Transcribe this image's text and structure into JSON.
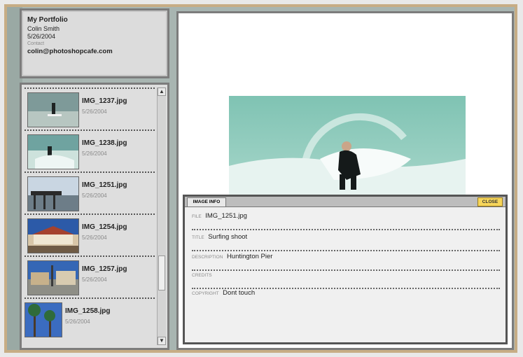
{
  "portfolio": {
    "title": "My Portfolio",
    "author": "Colin Smith",
    "date": "5/26/2004",
    "contact_label": "Contact",
    "email": "colin@photoshopcafe.com"
  },
  "thumbnails": [
    {
      "name": "IMG_1237.jpg",
      "date": "5/26/2004"
    },
    {
      "name": "IMG_1238.jpg",
      "date": "5/26/2004"
    },
    {
      "name": "IMG_1251.jpg",
      "date": "5/26/2004"
    },
    {
      "name": "IMG_1254.jpg",
      "date": "5/26/2004"
    },
    {
      "name": "IMG_1257.jpg",
      "date": "5/26/2004"
    },
    {
      "name": "IMG_1258.jpg",
      "date": "5/26/2004"
    }
  ],
  "scrollbar": {
    "up_icon": "▲",
    "down_icon": "▼"
  },
  "image_info": {
    "tab_label": "IMAGE INFO",
    "close_label": "CLOSE",
    "fields": [
      {
        "label": "file",
        "value": "IMG_1251.jpg"
      },
      {
        "label": "title",
        "value": "Surfing shoot"
      },
      {
        "label": "description",
        "value": "Huntington Pier"
      },
      {
        "label": "credits",
        "value": ""
      },
      {
        "label": "copyright",
        "value": "Dont touch"
      }
    ]
  },
  "colors": {
    "frame_border": "#c7ad85",
    "panel_border": "#7c7c7c",
    "close_button": "#f6d55a"
  }
}
